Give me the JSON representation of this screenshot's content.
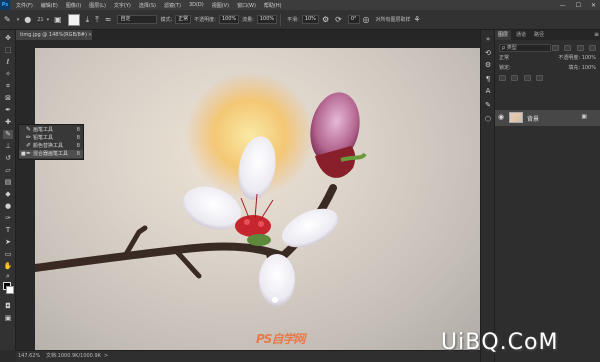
{
  "app": {
    "logo": "Ps"
  },
  "menu": [
    "文件(F)",
    "编辑(E)",
    "图像(I)",
    "图层(L)",
    "文字(Y)",
    "选择(S)",
    "滤镜(T)",
    "3D(D)",
    "视图(V)",
    "窗口(W)",
    "帮助(H)"
  ],
  "window_controls": [
    "—",
    "☐",
    "✕"
  ],
  "options": {
    "brush_size": "21",
    "mode_label": "模式:",
    "mode_value": "正常",
    "opacity_label": "不透明度:",
    "opacity_value": "100%",
    "flow_label": "流量:",
    "flow_value": "100%",
    "smoothing_label": "平滑:",
    "smoothing_value": "10%",
    "extra_field": "0°",
    "checkbox_label": "对所有图层取样"
  },
  "document": {
    "tab_title": "timg.jpg @ 148%(RGB/8#)",
    "close": "×"
  },
  "flyout": {
    "items": [
      {
        "label": "画笔工具",
        "key": "B",
        "icon": "brush-icon",
        "selected": false
      },
      {
        "label": "铅笔工具",
        "key": "B",
        "icon": "pencil-icon",
        "selected": false
      },
      {
        "label": "颜色替换工具",
        "key": "B",
        "icon": "color-replace-icon",
        "selected": false
      },
      {
        "label": "混合器画笔工具",
        "key": "B",
        "icon": "mixer-brush-icon",
        "selected": true
      }
    ],
    "selected_mark": "■"
  },
  "status": {
    "zoom": "147.62%",
    "doc_info": "文档:1000.9K/1000.9K",
    "arrow": ">"
  },
  "panel": {
    "tabs": [
      "图层",
      "通道",
      "路径"
    ],
    "menu": "≡",
    "search_placeholder": "ρ 类型",
    "blend_mode": "正常",
    "opacity": "不透明度: 100%",
    "lock": "锁定:",
    "fill": "填充: 100%",
    "layer_name": "背景",
    "lock_icon": "🔒",
    "eye_icon": "👁"
  },
  "watermark": {
    "logo": "PS自学网",
    "site": "UiBQ.CoM"
  },
  "colors": {
    "accent": "#31a8ff",
    "foreground": "#000000",
    "background": "#ffffff"
  }
}
